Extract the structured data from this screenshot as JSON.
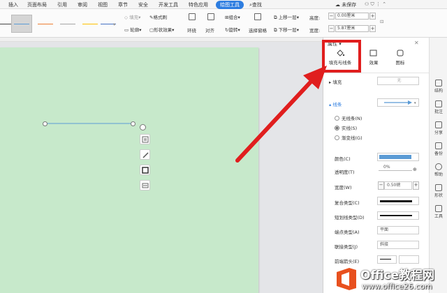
{
  "menubar": {
    "items": [
      "插入",
      "页面布局",
      "引用",
      "审阅",
      "视图",
      "章节",
      "安全",
      "开发工具",
      "特色应用"
    ],
    "active_tab": "绘图工具",
    "search": "查找",
    "save_status": "未保存"
  },
  "ribbon": {
    "fill_label": "填充",
    "format_brush": "格式刷",
    "outline_label": "轮廓",
    "shape_effect": "形状效果",
    "wrap": "环绕",
    "align": "对齐",
    "group": "组合",
    "rotate": "旋转",
    "select_pane": "选择窗格",
    "bring_forward": "上移一层",
    "send_backward": "下移一层",
    "height_label": "高度:",
    "height_value": "0.00厘米",
    "width_label": "宽度:",
    "width_value": "5.87厘米"
  },
  "panel": {
    "title": "属性",
    "tabs": [
      "填充与线条",
      "效果",
      "图标"
    ],
    "fill_section": "填充",
    "fill_value": "无",
    "line_section": "线条",
    "line_options": [
      "无线条(N)",
      "实线(S)",
      "渐变线(G)"
    ],
    "color_label": "颜色(C)",
    "transparency_label": "透明度(T)",
    "transparency_value": "0%",
    "width_label": "宽度(W)",
    "width_value": "0.50磅",
    "compound_label": "复合类型(C)",
    "dash_label": "短划线类型(D)",
    "cap_label": "端点类型(A)",
    "cap_value": "平面",
    "join_label": "联接类型(J)",
    "join_value": "斜接",
    "arrow_label": "前端箭头(E)"
  },
  "sidebar": {
    "items": [
      "结构",
      "批注",
      "分享",
      "备份",
      "帮助",
      "形状",
      "工具"
    ]
  },
  "watermark": {
    "brand": "Office教程网",
    "url": "www.office26.com"
  },
  "colors": {
    "accent": "#2d7de0",
    "highlight": "#e01e1e",
    "page_bg": "#c7e9cb",
    "line_color": "#5b9bd5"
  }
}
